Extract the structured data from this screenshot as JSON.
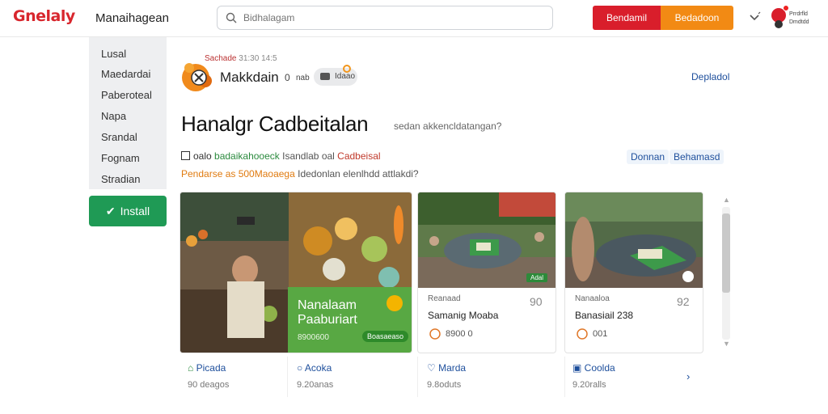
{
  "header": {
    "logo": "Gnelaly",
    "brand": "Manaihagean",
    "search_placeholder": "Bidhalagam",
    "btn_red": "Bendamil",
    "btn_orange": "Bedadoon",
    "user_line1": "Prrdrfld",
    "user_line2": "Dmdtdd"
  },
  "sidebar": {
    "items": [
      "Lusal",
      "Maedardai",
      "Paberoteal",
      "Napa",
      "Srandal",
      "Fognam",
      "Stradian"
    ],
    "install_label": "Install"
  },
  "app": {
    "meta_red": "Sachade",
    "meta_muted": "31:30 14:5",
    "name": "Makkdain",
    "count": "0",
    "pill_label": "nab",
    "pill2_label": "Idaao",
    "right_link": "Depladol",
    "title": "Hanalgr Cadbeitalan",
    "subtitle": "sedan akkencldatangan?",
    "meta1_prefix": "oalo",
    "meta1_green": "badaikahooeck",
    "meta1_muted": "Isandlab  oal",
    "meta1_red": "Cadbeisal",
    "meta2_orange": "Pendarse as 500Maoaega",
    "meta2_muted": "Idedonlan  elenlhdd attlakdi?",
    "chips": [
      "Donnan",
      "Behamasd"
    ]
  },
  "cards": [
    {
      "panel_line1": "Nanalaam",
      "panel_line2": "Paaburiart",
      "panel_price": "8900600",
      "panel_btn": "Boasaeaso",
      "foot_name_a": "Picada",
      "foot_sub_a": "90 deagos",
      "foot_name_b": "Acoka",
      "foot_sub_b": "9.20anas"
    },
    {
      "badge": "Adal",
      "label": "Reanaad",
      "name": "Samanig Moaba",
      "num": "90",
      "stats": "8900   0",
      "foot_name": "Marda",
      "foot_sub": "9.8oduts"
    },
    {
      "label": "Nanaaloa",
      "name": "Banasiail 238",
      "num": "92",
      "stats": "001",
      "foot_name": "Coolda",
      "foot_sub": "9.20ralls"
    }
  ],
  "icons": {
    "search": "search-icon",
    "chevron": "chevron-down-icon",
    "check": "check-icon",
    "camera": "camera-icon",
    "next": "chevron-right-icon"
  },
  "colors": {
    "brand_red": "#d91e2b",
    "orange": "#f28a14",
    "install_green": "#1f9a55",
    "link_blue": "#1e4f9c",
    "panel_green": "#58a843"
  }
}
